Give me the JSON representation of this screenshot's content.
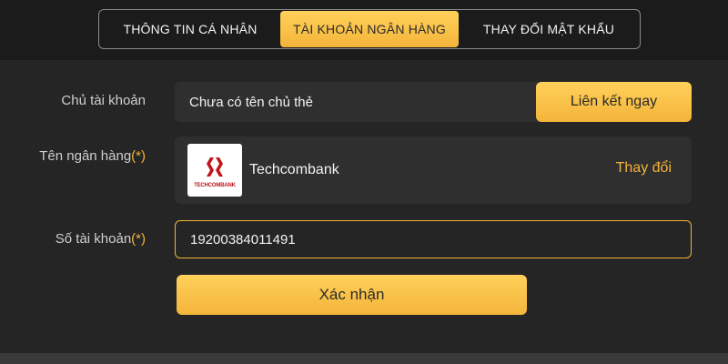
{
  "tabs": [
    {
      "label": "THÔNG TIN CÁ NHÂN",
      "active": false
    },
    {
      "label": "TÀI KHOẢN NGÂN HÀNG",
      "active": true
    },
    {
      "label": "THAY ĐỔI MẬT KHẨU",
      "active": false
    }
  ],
  "form": {
    "holder_label": "Chủ tài khoản",
    "holder_value": "Chưa có tên chủ thẻ",
    "link_button": "Liên kết ngay",
    "bank_label": "Tên ngân hàng",
    "bank_required": "(*)",
    "bank_name": "Techcombank",
    "bank_logo_text": "TECHCOMBANK",
    "change_link": "Thay đổi",
    "account_label": "Số tài khoản",
    "account_required": "(*)",
    "account_value": "19200384011491",
    "confirm_button": "Xác nhận"
  },
  "colors": {
    "accent": "#f4b43a",
    "background": "#252525",
    "field": "#2f2f2f"
  }
}
